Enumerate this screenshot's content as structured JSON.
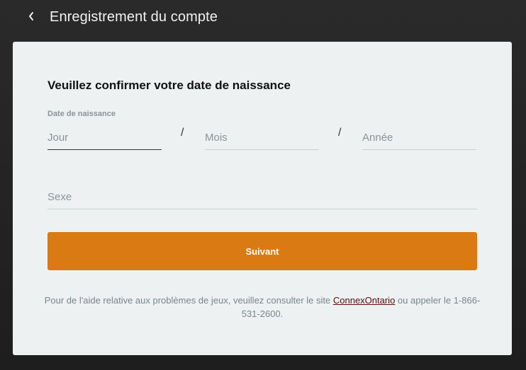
{
  "header": {
    "title": "Enregistrement du compte",
    "back_icon": "chevron-left-icon"
  },
  "form": {
    "title": "Veuillez confirmer votre date de naissance",
    "dob_label": "Date de naissance",
    "day_placeholder": "Jour",
    "month_placeholder": "Mois",
    "year_placeholder": "Année",
    "separator": "/",
    "sex_placeholder": "Sexe",
    "next_label": "Suivant"
  },
  "help": {
    "text_before": "Pour de l'aide relative aux problèmes de jeux, veuillez consulter le site ",
    "link_text": "ConnexOntario",
    "text_after": " ou appeler le 1-866-531-2600."
  },
  "colors": {
    "accent": "#d97b12",
    "card_bg": "#edf1f2",
    "link": "#5b0b0b"
  }
}
